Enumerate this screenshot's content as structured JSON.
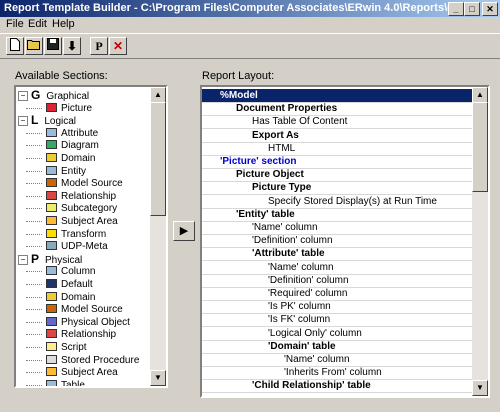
{
  "window": {
    "title": "Report Template Builder - C:\\Program Files\\Computer Associates\\ERwin 4.0\\Reports\\demo",
    "min_glyph": "_",
    "max_glyph": "□",
    "close_glyph": "✕"
  },
  "menu": [
    "File",
    "Edit",
    "Help"
  ],
  "toolbar": {
    "new_icon": "new-document-icon",
    "open_icon": "open-folder-icon",
    "save_icon": "save-disk-icon",
    "down_icon": "down-arrow-icon",
    "props_label": "P",
    "delete_label": "✕",
    "delete_color": "#cc0000"
  },
  "sections_label": "Available Sections:",
  "layout_label": "Report Layout:",
  "add_button": "▶",
  "tree": [
    {
      "kind": "cat",
      "expander": "−",
      "letter": "G",
      "label": "Graphical"
    },
    {
      "kind": "item",
      "icon": "picture-icon",
      "label": "Picture"
    },
    {
      "kind": "cat",
      "expander": "−",
      "letter": "L",
      "label": "Logical"
    },
    {
      "kind": "item",
      "icon": "attribute-icon",
      "label": "Attribute"
    },
    {
      "kind": "item",
      "icon": "diagram-icon",
      "label": "Diagram"
    },
    {
      "kind": "item",
      "icon": "domain-icon",
      "label": "Domain"
    },
    {
      "kind": "item",
      "icon": "entity-icon",
      "label": "Entity"
    },
    {
      "kind": "item",
      "icon": "model-source-icon",
      "label": "Model Source"
    },
    {
      "kind": "item",
      "icon": "relationship-icon",
      "label": "Relationship"
    },
    {
      "kind": "item",
      "icon": "subcategory-icon",
      "label": "Subcategory"
    },
    {
      "kind": "item",
      "icon": "subject-area-icon",
      "label": "Subject Area"
    },
    {
      "kind": "item",
      "icon": "transform-icon",
      "label": "Transform"
    },
    {
      "kind": "item",
      "icon": "udp-meta-icon",
      "label": "UDP-Meta"
    },
    {
      "kind": "cat",
      "expander": "−",
      "letter": "P",
      "label": "Physical"
    },
    {
      "kind": "item",
      "icon": "column-icon",
      "label": "Column"
    },
    {
      "kind": "item",
      "icon": "default-icon",
      "label": "Default"
    },
    {
      "kind": "item",
      "icon": "domain-icon",
      "label": "Domain"
    },
    {
      "kind": "item",
      "icon": "model-source-icon",
      "label": "Model Source"
    },
    {
      "kind": "item",
      "icon": "physical-object-icon",
      "label": "Physical Object"
    },
    {
      "kind": "item",
      "icon": "relationship-icon",
      "label": "Relationship"
    },
    {
      "kind": "item",
      "icon": "script-icon",
      "label": "Script"
    },
    {
      "kind": "item",
      "icon": "stored-procedure-icon",
      "label": "Stored Procedure"
    },
    {
      "kind": "item",
      "icon": "subject-area-icon",
      "label": "Subject Area"
    },
    {
      "kind": "item",
      "icon": "table-icon",
      "label": "Table"
    }
  ],
  "layout": [
    {
      "text": "%Model",
      "level": 0,
      "bold": true,
      "selected": true
    },
    {
      "text": "Document Properties",
      "level": 1,
      "bold": true
    },
    {
      "text": "Has Table Of Content",
      "level": 2,
      "bold": false
    },
    {
      "text": "Export As",
      "level": 2,
      "bold": true
    },
    {
      "text": "HTML",
      "level": 3,
      "bold": false
    },
    {
      "text": "'Picture' section",
      "level": 0,
      "bold": true,
      "blue": true
    },
    {
      "text": "Picture Object",
      "level": 1,
      "bold": true
    },
    {
      "text": "Picture Type",
      "level": 2,
      "bold": true
    },
    {
      "text": "Specify Stored Display(s) at Run Time",
      "level": 3,
      "bold": false
    },
    {
      "text": "'Entity' table",
      "level": 1,
      "bold": true
    },
    {
      "text": "'Name' column",
      "level": 2,
      "bold": false
    },
    {
      "text": "'Definition' column",
      "level": 2,
      "bold": false
    },
    {
      "text": "'Attribute' table",
      "level": 2,
      "bold": true
    },
    {
      "text": "'Name' column",
      "level": 3,
      "bold": false
    },
    {
      "text": "'Definition' column",
      "level": 3,
      "bold": false
    },
    {
      "text": "'Required' column",
      "level": 3,
      "bold": false
    },
    {
      "text": "'Is PK' column",
      "level": 3,
      "bold": false
    },
    {
      "text": "'Is FK' column",
      "level": 3,
      "bold": false
    },
    {
      "text": "'Logical Only' column",
      "level": 3,
      "bold": false
    },
    {
      "text": "'Domain' table",
      "level": 3,
      "bold": true
    },
    {
      "text": "'Name' column",
      "level": 4,
      "bold": false
    },
    {
      "text": "'Inherits From' column",
      "level": 4,
      "bold": false
    },
    {
      "text": "'Child Relationship' table",
      "level": 2,
      "bold": true
    }
  ],
  "colors": {
    "selection": "#0a246a",
    "section_blue": "#0000cc"
  }
}
